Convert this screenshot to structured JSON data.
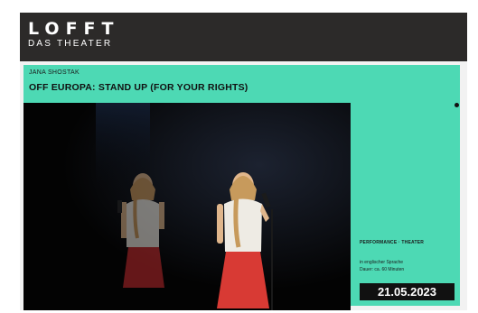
{
  "logo": {
    "name": "LOFFT",
    "tagline": "DAS THEATER"
  },
  "event": {
    "artist": "JANA SHOSTAK",
    "title": "OFF EUROPA: STAND UP (FOR YOUR RIGHTS)",
    "tags": "PERFORMANCE · THEATER",
    "language": "in englischer Sprache",
    "duration": "Dauer: ca. 60 Minuten",
    "date": "21.05.2023"
  },
  "photo": {
    "subject": "performer-with-microphone-and-reflection"
  },
  "colors": {
    "header": "#2c2a29",
    "accent": "#4dd9b4",
    "photo_bg": "#050505",
    "date_box": "#111111"
  }
}
